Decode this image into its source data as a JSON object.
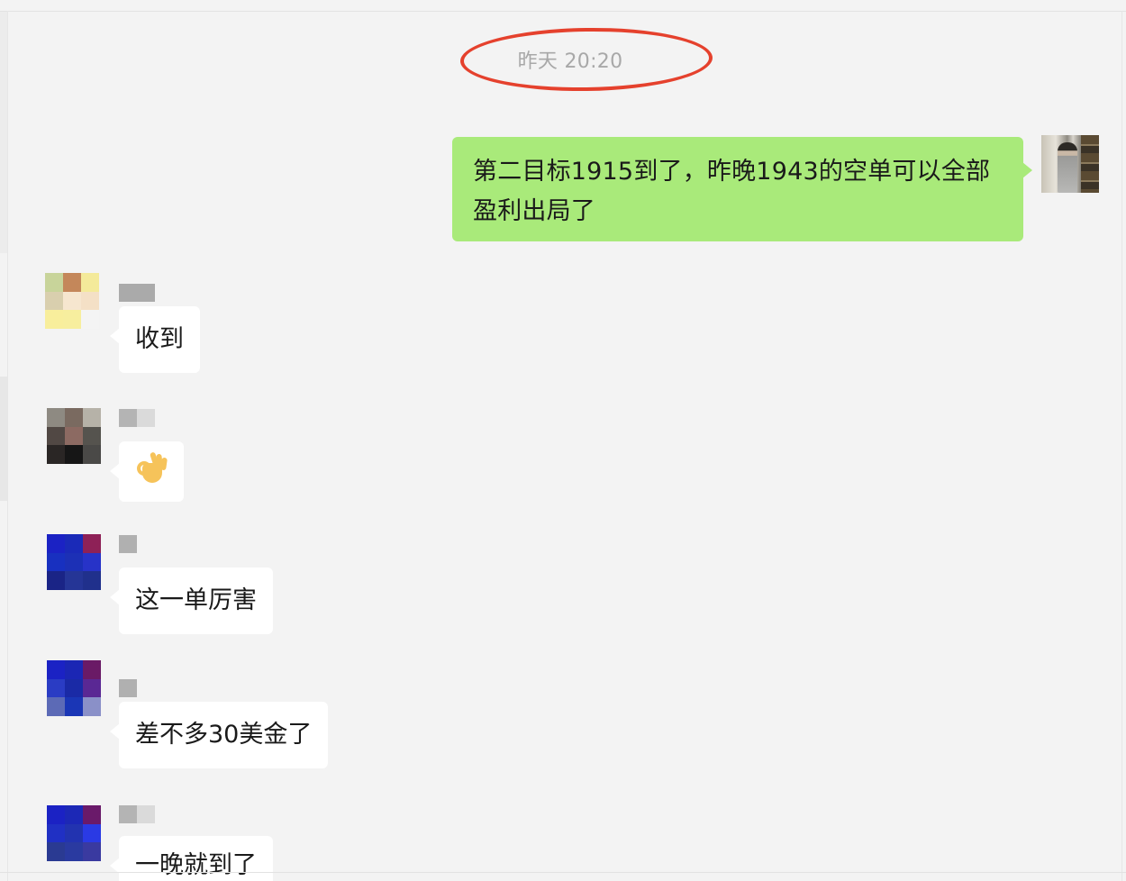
{
  "conversation": {
    "timestamp": "昨天 20:20",
    "messages": [
      {
        "id": "msg-self-1",
        "sender": "self",
        "text_line1": "第二目标1915到了，昨晚1943的空单可以全部",
        "text_line2": "盈利出局了"
      },
      {
        "id": "msg-2",
        "sender": "other",
        "text": "收到"
      },
      {
        "id": "msg-3",
        "sender": "other",
        "emoji": "ok-hand-emoji"
      },
      {
        "id": "msg-4",
        "sender": "other",
        "text": "这一单厉害"
      },
      {
        "id": "msg-5",
        "sender": "other",
        "text": "差不多30美金了"
      },
      {
        "id": "msg-6",
        "sender": "other",
        "text": "一晚就到了"
      }
    ]
  },
  "colors": {
    "self_bubble": "#a9ea7a",
    "other_bubble": "#ffffff",
    "background": "#f3f3f3",
    "timestamp_text": "#a8a8a8",
    "annotation_circle": "#e5412d"
  },
  "icons": {
    "annotation": "red-ellipse-highlight",
    "emoji": "ok-hand-emoji"
  }
}
